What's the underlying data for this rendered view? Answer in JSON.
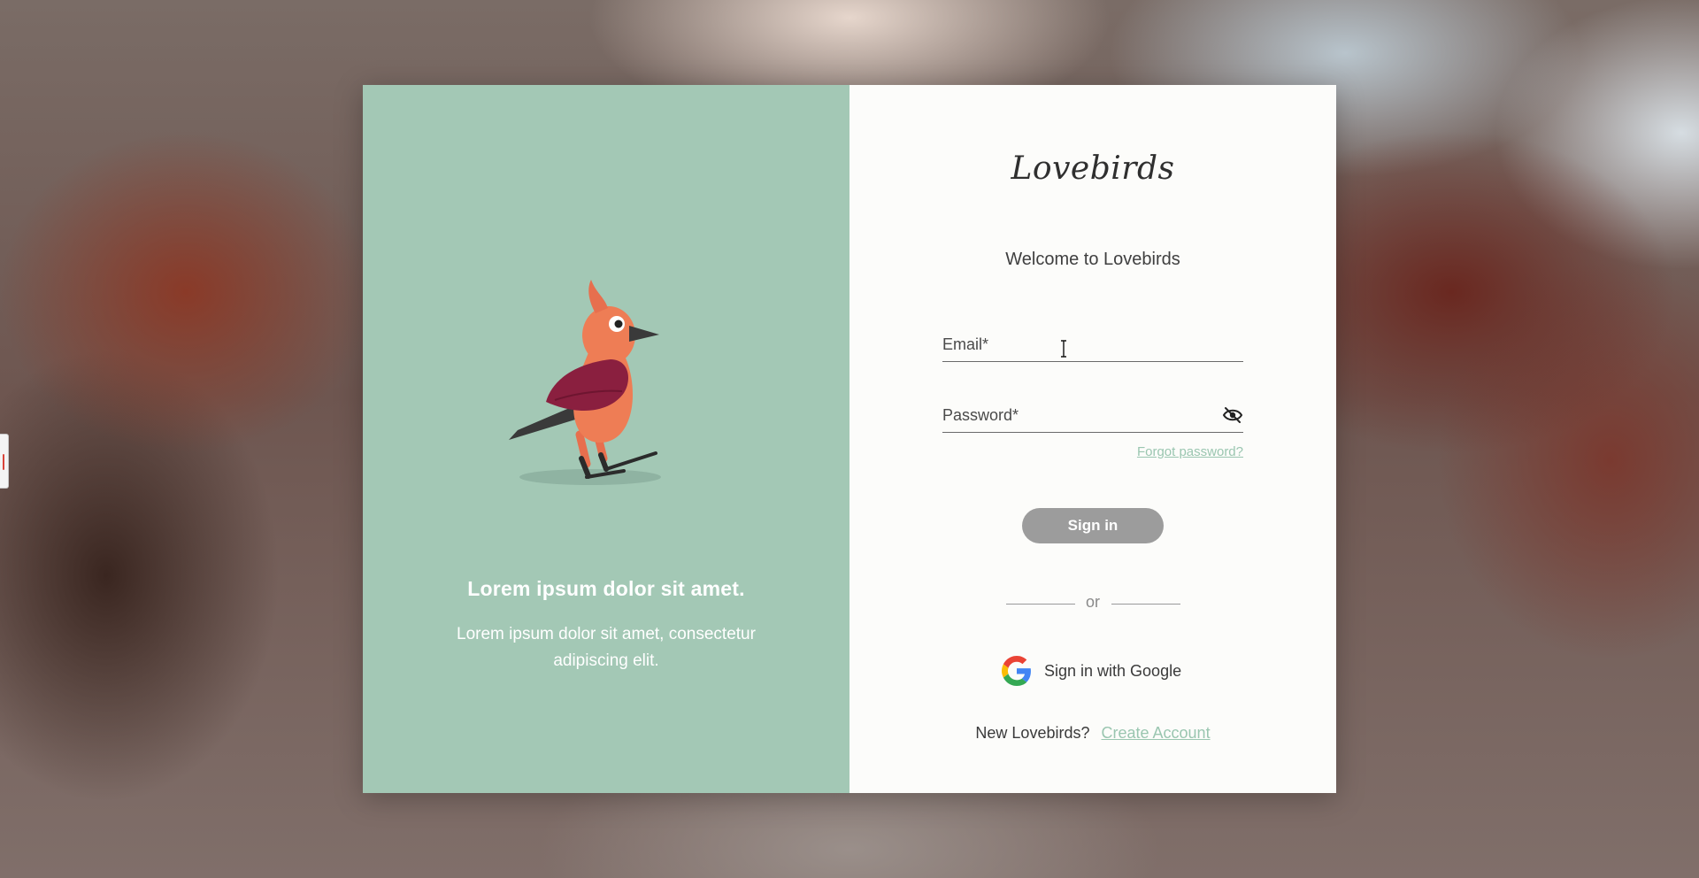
{
  "hero": {
    "heading": "Lorem ipsum dolor sit amet.",
    "subtext": "Lorem ipsum dolor sit amet, consectetur adipiscing elit."
  },
  "brand": {
    "logo_text": "Lovebirds"
  },
  "form": {
    "welcome": "Welcome to Lovebirds",
    "email": {
      "placeholder": "Email*",
      "value": ""
    },
    "password": {
      "placeholder": "Password*",
      "value": "",
      "toggle_icon": "eye-off-icon"
    },
    "forgot_label": "Forgot password?",
    "signin_label": "Sign in",
    "divider_text": "or",
    "google_label": "Sign in with Google",
    "signup_prompt": "New Lovebirds?",
    "create_account_label": "Create Account"
  },
  "colors": {
    "panel_green": "#a3c8b5",
    "link_green": "#9ac6b0",
    "button_gray": "#9c9c9c",
    "card_white": "#fcfcfa"
  }
}
